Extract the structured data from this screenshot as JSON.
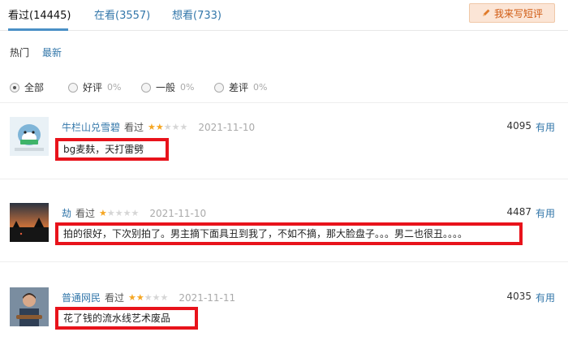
{
  "tabs": [
    {
      "label": "看过(14445)",
      "active": true
    },
    {
      "label": "在看(3557)",
      "active": false
    },
    {
      "label": "想看(733)",
      "active": false
    }
  ],
  "write_button": {
    "label": "我来写短评",
    "icon": "pencil-icon"
  },
  "sort": [
    {
      "label": "热门",
      "active": true
    },
    {
      "label": "最新",
      "active": false
    }
  ],
  "filters": [
    {
      "label": "全部",
      "percent": "",
      "selected": true
    },
    {
      "label": "好评",
      "percent": "0%",
      "selected": false
    },
    {
      "label": "一般",
      "percent": "0%",
      "selected": false
    },
    {
      "label": "差评",
      "percent": "0%",
      "selected": false
    }
  ],
  "reviews": [
    {
      "author": "牛栏山兑雪碧",
      "status": "看过",
      "rating": 2,
      "max_rating": 5,
      "date": "2021-11-10",
      "votes": "4095",
      "useful_label": "有用",
      "content": "bg麦麸，天打雷劈"
    },
    {
      "author": "劫",
      "status": "看过",
      "rating": 1,
      "max_rating": 5,
      "date": "2021-11-10",
      "votes": "4487",
      "useful_label": "有用",
      "content": "拍的很好，下次别拍了。男主摘下面具丑到我了，不如不摘，那大脸盘子。。。男二也很丑。。。。"
    },
    {
      "author": "普通网民",
      "status": "看过",
      "rating": 2,
      "max_rating": 5,
      "date": "2021-11-11",
      "votes": "4035",
      "useful_label": "有用",
      "content": "花了钱的流水线艺术废品"
    }
  ],
  "colors": {
    "link": "#3377aa",
    "star": "#f5a623",
    "highlight_box": "#e8131b",
    "button_bg": "#fbe5d6"
  }
}
